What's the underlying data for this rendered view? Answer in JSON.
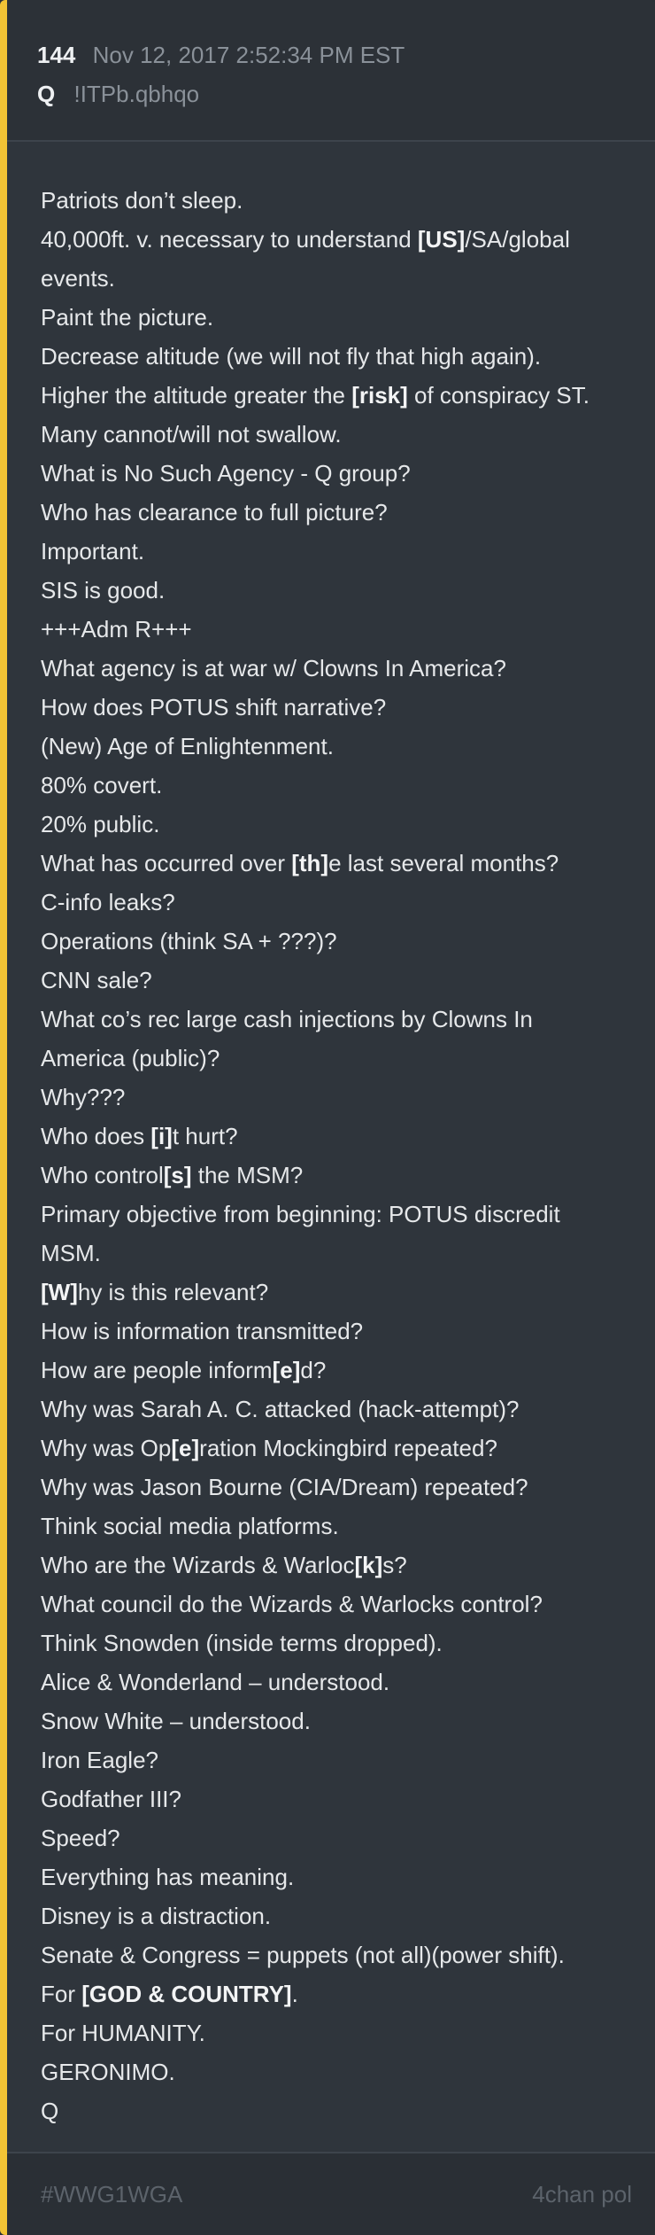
{
  "post": {
    "number": "144",
    "timestamp": "Nov 12, 2017 2:52:34 PM EST",
    "author": "Q",
    "tripcode": "!ITPb.qbhqo"
  },
  "lines": [
    [
      {
        "t": "Patriots don’t sleep."
      }
    ],
    [
      {
        "t": "40,000ft. v. necessary to understand "
      },
      {
        "t": "[US]",
        "b": true
      },
      {
        "t": "/SA/global"
      }
    ],
    [
      {
        "t": "events."
      }
    ],
    [
      {
        "t": "Paint the picture."
      }
    ],
    [
      {
        "t": "Decrease altitude (we will not fly that high again)."
      }
    ],
    [
      {
        "t": "Higher the altitude greater the "
      },
      {
        "t": "[risk]",
        "b": true
      },
      {
        "t": " of conspiracy ST."
      }
    ],
    [
      {
        "t": "Many cannot/will not swallow."
      }
    ],
    [
      {
        "t": "What is No Such Agency - Q group?"
      }
    ],
    [
      {
        "t": "Who has clearance to full picture?"
      }
    ],
    [
      {
        "t": "Important."
      }
    ],
    [
      {
        "t": "SIS is good."
      }
    ],
    [
      {
        "t": "+++Adm R+++"
      }
    ],
    [
      {
        "t": "What agency is at war w/ Clowns In America?"
      }
    ],
    [
      {
        "t": "How does POTUS shift narrative?"
      }
    ],
    [
      {
        "t": "(New) Age of Enlightenment."
      }
    ],
    [
      {
        "t": "80% covert."
      }
    ],
    [
      {
        "t": "20% public."
      }
    ],
    [
      {
        "t": "What has occurred over "
      },
      {
        "t": "[th]",
        "b": true
      },
      {
        "t": "e last several months?"
      }
    ],
    [
      {
        "t": "C-info leaks?"
      }
    ],
    [
      {
        "t": "Operations (think SA + ???)?"
      }
    ],
    [
      {
        "t": "CNN sale?"
      }
    ],
    [
      {
        "t": "What co’s rec large cash injections by Clowns In"
      }
    ],
    [
      {
        "t": "America (public)?"
      }
    ],
    [
      {
        "t": "Why???"
      }
    ],
    [
      {
        "t": "Who does "
      },
      {
        "t": "[i]",
        "b": true
      },
      {
        "t": "t hurt?"
      }
    ],
    [
      {
        "t": "Who control"
      },
      {
        "t": "[s]",
        "b": true
      },
      {
        "t": " the MSM?"
      }
    ],
    [
      {
        "t": "Primary objective from beginning: POTUS discredit"
      }
    ],
    [
      {
        "t": "MSM."
      }
    ],
    [
      {
        "t": "[W]",
        "b": true
      },
      {
        "t": "hy is this relevant?"
      }
    ],
    [
      {
        "t": "How is information transmitted?"
      }
    ],
    [
      {
        "t": "How are people inform"
      },
      {
        "t": "[e]",
        "b": true
      },
      {
        "t": "d?"
      }
    ],
    [
      {
        "t": "Why was Sarah A. C. attacked (hack-attempt)?"
      }
    ],
    [
      {
        "t": "Why was Op"
      },
      {
        "t": "[e]",
        "b": true
      },
      {
        "t": "ration Mockingbird repeated?"
      }
    ],
    [
      {
        "t": "Why was Jason Bourne (CIA/Dream) repeated?"
      }
    ],
    [
      {
        "t": "Think social media platforms."
      }
    ],
    [
      {
        "t": "Who are the Wizards & Warloc"
      },
      {
        "t": "[k]",
        "b": true
      },
      {
        "t": "s?"
      }
    ],
    [
      {
        "t": "What council do the Wizards & Warlocks control?"
      }
    ],
    [
      {
        "t": "Think Snowden (inside terms dropped)."
      }
    ],
    [
      {
        "t": "Alice & Wonderland – understood."
      }
    ],
    [
      {
        "t": "Snow White – understood."
      }
    ],
    [
      {
        "t": "Iron Eagle?"
      }
    ],
    [
      {
        "t": "Godfather III?"
      }
    ],
    [
      {
        "t": "Speed?"
      }
    ],
    [
      {
        "t": "Everything has meaning."
      }
    ],
    [
      {
        "t": "Disney is a distraction."
      }
    ],
    [
      {
        "t": "Senate & Congress = puppets (not all)(power shift)."
      }
    ],
    [
      {
        "t": "For "
      },
      {
        "t": "[GOD & COUNTRY]",
        "b": true
      },
      {
        "t": "."
      }
    ],
    [
      {
        "t": "For HUMANITY."
      }
    ],
    [
      {
        "t": "GERONIMO."
      }
    ],
    [
      {
        "t": "Q"
      }
    ]
  ],
  "footer": {
    "hashtag": "#WWG1WGA",
    "source": "4chan pol"
  },
  "colors": {
    "accent": "#f2c335",
    "background": "#2f353c",
    "text": "#e6e8ea",
    "muted": "#8a9199"
  }
}
